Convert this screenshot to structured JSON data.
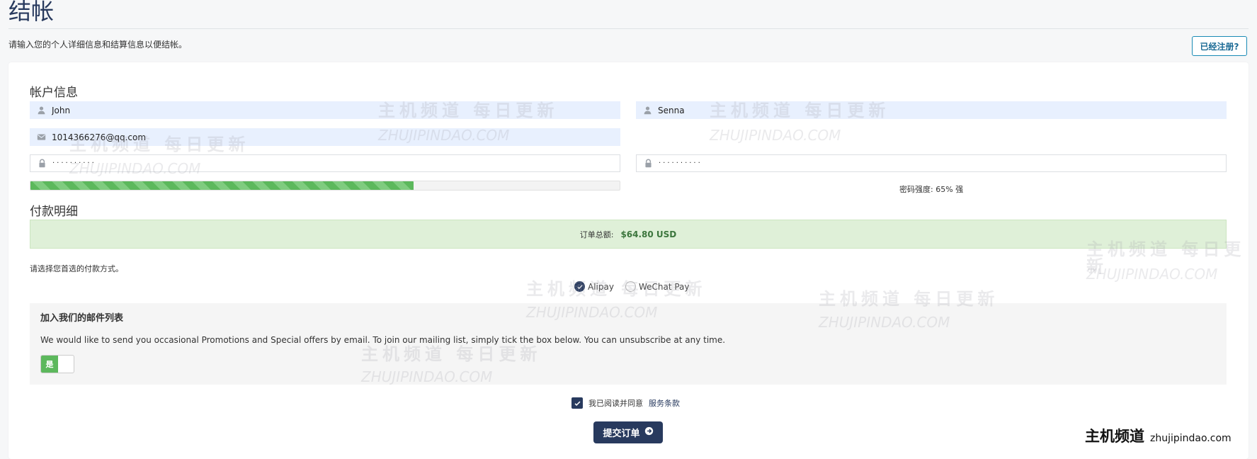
{
  "header": {
    "title": "结帐",
    "subtitle": "请输入您的个人详细信息和结算信息以便结帐。",
    "login_button": "已经注册?"
  },
  "account": {
    "section_title": "帐户信息",
    "first_name": "John",
    "last_name": "Senna",
    "email": "1014366276@qq.com",
    "password_mask": "··········",
    "confirm_password_mask": "··········",
    "strength_percent": 65,
    "strength_text": "密码强度: 65% 强"
  },
  "payment": {
    "section_title": "付款明细",
    "total_label": "订单总额:",
    "total_value": "$64.80 USD",
    "method_prompt": "请选择您首选的付款方式。",
    "methods": [
      {
        "label": "Alipay",
        "selected": true
      },
      {
        "label": "WeChat Pay",
        "selected": false
      }
    ]
  },
  "mailing": {
    "title": "加入我们的邮件列表",
    "description": "We would like to send you occasional Promotions and Special offers by email. To join our mailing list, simply tick the box below. You can unsubscribe at any time.",
    "toggle_on_label": "是"
  },
  "terms": {
    "text": "我已阅读并同意",
    "link": "服务条款"
  },
  "submit": {
    "label": "提交订单"
  },
  "watermark": {
    "zh": "主机频道 每日更新",
    "en": "ZHUJIPINDAO.COM"
  },
  "brand": {
    "zh": "主机频道",
    "en": "zhujipindao.com"
  },
  "colors": {
    "primary": "#283a5e",
    "success": "#5cb85c",
    "info_border": "#1a8bb5",
    "total_bg": "#dff0d8"
  }
}
